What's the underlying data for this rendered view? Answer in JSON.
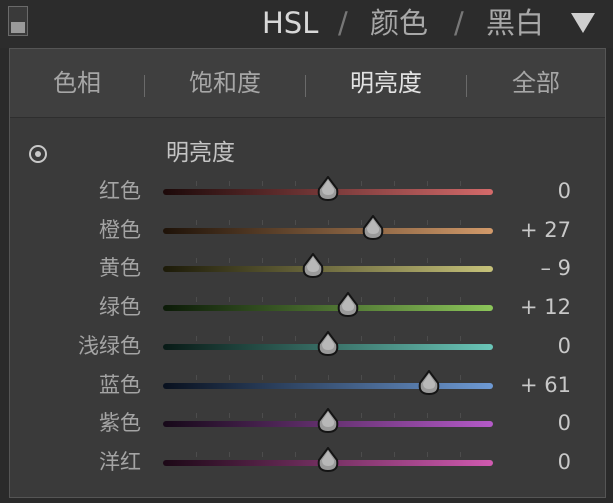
{
  "header": {
    "items": [
      {
        "label": "HSL",
        "active": true
      },
      {
        "label": "颜色",
        "active": false
      },
      {
        "label": "黑白",
        "active": false
      }
    ],
    "separator": "/"
  },
  "tabs": [
    {
      "label": "色相",
      "active": false
    },
    {
      "label": "饱和度",
      "active": false
    },
    {
      "label": "明亮度",
      "active": true
    },
    {
      "label": "全部",
      "active": false
    }
  ],
  "section": {
    "title": "明亮度"
  },
  "sliders": [
    {
      "label": "红色",
      "value": "0",
      "numeric": 0,
      "track_start": "#1c0909",
      "track_end": "#d46a6a"
    },
    {
      "label": "橙色",
      "value": "+ 27",
      "numeric": 27,
      "track_start": "#1e1208",
      "track_end": "#d29a6a"
    },
    {
      "label": "黄色",
      "value": "– 9",
      "numeric": -9,
      "track_start": "#1c1a08",
      "track_end": "#c6c27a"
    },
    {
      "label": "绿色",
      "value": "+ 12",
      "numeric": 12,
      "track_start": "#0b1a07",
      "track_end": "#8cc65a"
    },
    {
      "label": "浅绿色",
      "value": "0",
      "numeric": 0,
      "track_start": "#081a16",
      "track_end": "#6ac6b8"
    },
    {
      "label": "蓝色",
      "value": "+ 61",
      "numeric": 61,
      "track_start": "#08101e",
      "track_end": "#6e9ad4"
    },
    {
      "label": "紫色",
      "value": "0",
      "numeric": 0,
      "track_start": "#160818",
      "track_end": "#b45ac8"
    },
    {
      "label": "洋红",
      "value": "0",
      "numeric": 0,
      "track_start": "#1c0816",
      "track_end": "#d05ab0"
    }
  ]
}
